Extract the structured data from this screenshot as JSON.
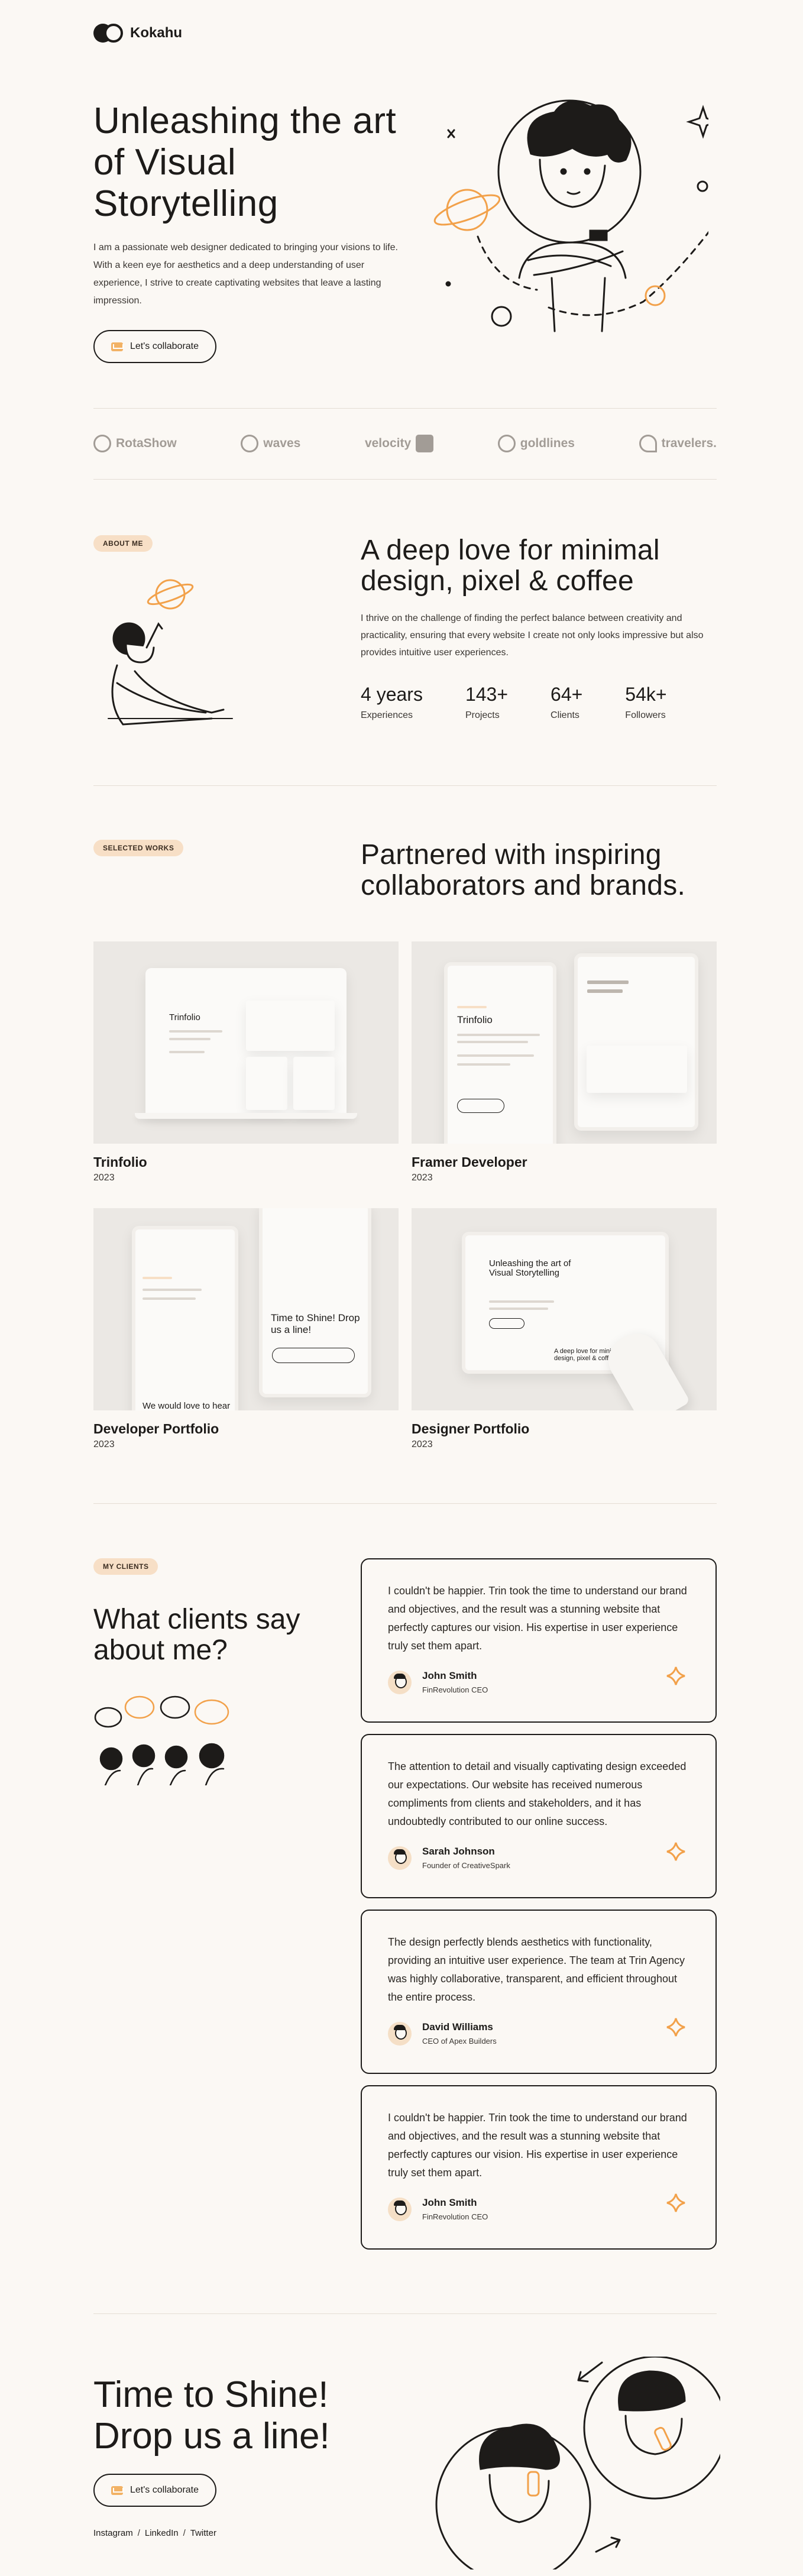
{
  "brand": {
    "name": "Kokahu"
  },
  "hero": {
    "title": "Unleashing the art of Visual Storytelling",
    "description": "I am a passionate web designer dedicated to bringing your visions to life. With a keen eye for aesthetics and a deep understanding of user experience, I strive to create captivating websites that leave a lasting impression.",
    "cta": "Let's collaborate"
  },
  "brands": [
    "RotaShow",
    "waves",
    "velocity",
    "goldlines",
    "travelers."
  ],
  "about": {
    "badge": "ABOUT ME",
    "title": "A deep love for minimal design, pixel & coffee",
    "text": "I thrive on the challenge of finding the perfect balance between creativity and practicality, ensuring that every website I create not only looks impressive but also provides intuitive user experiences.",
    "stats": [
      {
        "value": "4 years",
        "label": "Experiences"
      },
      {
        "value": "143+",
        "label": "Projects"
      },
      {
        "value": "64+",
        "label": "Clients"
      },
      {
        "value": "54k+",
        "label": "Followers"
      }
    ]
  },
  "works": {
    "badge": "SELECTED WORKS",
    "title": "Partnered with inspiring collaborators and brands.",
    "items": [
      {
        "title": "Trinfolio",
        "year": "2023",
        "mock_heading": "Trinfolio"
      },
      {
        "title": "Framer Developer",
        "year": "2023",
        "mock_heading": "Trinfolio"
      },
      {
        "title": "Developer Portfolio",
        "year": "2023",
        "mock_heading": "Time to Shine! Drop us a line!",
        "mock_sub": "We would love to hear From you!"
      },
      {
        "title": "Designer Portfolio",
        "year": "2023",
        "mock_heading": "Unleashing the art of Visual Storytelling",
        "mock_sub": "A deep love for minimal design, pixel & coffee"
      }
    ]
  },
  "clients": {
    "badge": "MY CLIENTS",
    "title": "What clients say about me?",
    "testimonials": [
      {
        "quote": "I couldn't be happier. Trin took the time to understand our brand and objectives, and the result was a stunning website that perfectly captures our vision. His expertise in user experience truly set them apart.",
        "name": "John Smith",
        "role": "FinRevolution CEO"
      },
      {
        "quote": "The attention to detail and visually captivating design exceeded our expectations. Our website has received numerous compliments from clients and stakeholders, and it has undoubtedly contributed to our online success.",
        "name": "Sarah Johnson",
        "role": "Founder of CreativeSpark"
      },
      {
        "quote": "The design perfectly blends aesthetics with functionality, providing an intuitive user experience. The team at Trin Agency was highly collaborative, transparent, and efficient throughout the entire process.",
        "name": "David Williams",
        "role": "CEO of Apex Builders"
      },
      {
        "quote": "I couldn't be happier. Trin took the time to understand our brand and objectives, and the result was a stunning website that perfectly captures our vision. His expertise in user experience truly set them apart.",
        "name": "John Smith",
        "role": "FinRevolution CEO"
      }
    ]
  },
  "footer": {
    "title": "Time to Shine! Drop us a line!",
    "cta": "Let's collaborate",
    "social": [
      "Instagram",
      "LinkedIn",
      "Twitter"
    ],
    "separator": "/"
  },
  "colors": {
    "background": "#fbf8f4",
    "accent": "#f2a14a",
    "badge": "#f7dfc6",
    "text": "#1d1b19"
  }
}
